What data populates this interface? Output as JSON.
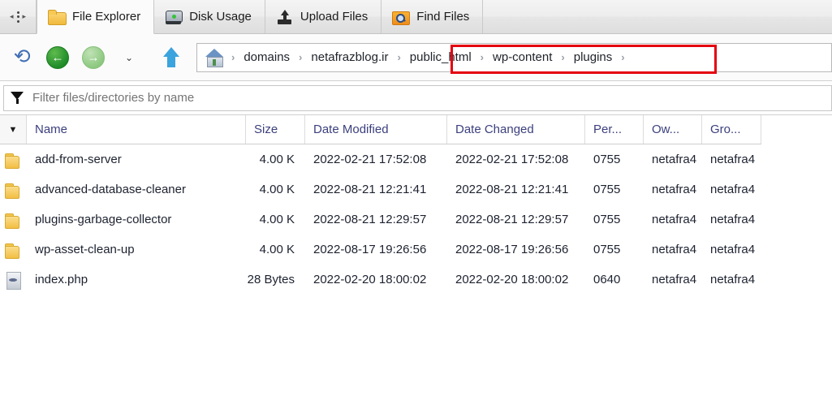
{
  "tabs": [
    {
      "label": "File Explorer",
      "icon": "folder-open-icon",
      "active": true
    },
    {
      "label": "Disk Usage",
      "icon": "disk-icon",
      "active": false
    },
    {
      "label": "Upload Files",
      "icon": "upload-icon",
      "active": false
    },
    {
      "label": "Find Files",
      "icon": "find-icon",
      "active": false
    }
  ],
  "tab_nav": {
    "prev": "◂",
    "next": "▸"
  },
  "toolbar": {
    "reload_icon": "reload-icon",
    "back_icon": "back-arrow-icon",
    "forward_icon": "forward-arrow-icon",
    "back_glyph": "←",
    "forward_glyph": "→",
    "dropdown_icon": "chevron-down-icon",
    "dropdown_glyph": "⌄",
    "up_icon": "up-arrow-icon"
  },
  "breadcrumb": {
    "home_icon": "home-icon",
    "separator": "›",
    "items": [
      {
        "label": "domains",
        "highlighted": false
      },
      {
        "label": "netafrazblog.ir",
        "highlighted": false
      },
      {
        "label": "public_html",
        "highlighted": true
      },
      {
        "label": "wp-content",
        "highlighted": true
      },
      {
        "label": "plugins",
        "highlighted": true
      }
    ],
    "highlight_color": "#e4000f"
  },
  "filter": {
    "icon": "filter-funnel-icon",
    "placeholder": "Filter files/directories by name",
    "value": ""
  },
  "table": {
    "select_all_icon": "chevron-down-icon",
    "select_all_glyph": "▼",
    "columns": [
      {
        "key": "name",
        "label": "Name"
      },
      {
        "key": "size",
        "label": "Size"
      },
      {
        "key": "date_modified",
        "label": "Date Modified"
      },
      {
        "key": "date_changed",
        "label": "Date Changed"
      },
      {
        "key": "permissions",
        "label": "Per..."
      },
      {
        "key": "owner",
        "label": "Ow..."
      },
      {
        "key": "group",
        "label": "Gro..."
      }
    ],
    "rows": [
      {
        "icon": "folder-icon",
        "type": "folder",
        "name": "add-from-server",
        "size": "4.00 K",
        "date_modified": "2022-02-21 17:52:08",
        "date_changed": "2022-02-21 17:52:08",
        "permissions": "0755",
        "owner": "netafra4",
        "group": "netafra4"
      },
      {
        "icon": "folder-icon",
        "type": "folder",
        "name": "advanced-database-cleaner",
        "size": "4.00 K",
        "date_modified": "2022-08-21 12:21:41",
        "date_changed": "2022-08-21 12:21:41",
        "permissions": "0755",
        "owner": "netafra4",
        "group": "netafra4"
      },
      {
        "icon": "folder-icon",
        "type": "folder",
        "name": "plugins-garbage-collector",
        "size": "4.00 K",
        "date_modified": "2022-08-21 12:29:57",
        "date_changed": "2022-08-21 12:29:57",
        "permissions": "0755",
        "owner": "netafra4",
        "group": "netafra4"
      },
      {
        "icon": "folder-icon",
        "type": "folder",
        "name": "wp-asset-clean-up",
        "size": "4.00 K",
        "date_modified": "2022-08-17 19:26:56",
        "date_changed": "2022-08-17 19:26:56",
        "permissions": "0755",
        "owner": "netafra4",
        "group": "netafra4"
      },
      {
        "icon": "file-icon",
        "type": "file",
        "name": "index.php",
        "size": "28 Bytes",
        "date_modified": "2022-02-20 18:00:02",
        "date_changed": "2022-02-20 18:00:02",
        "permissions": "0640",
        "owner": "netafra4",
        "group": "netafra4"
      }
    ]
  }
}
